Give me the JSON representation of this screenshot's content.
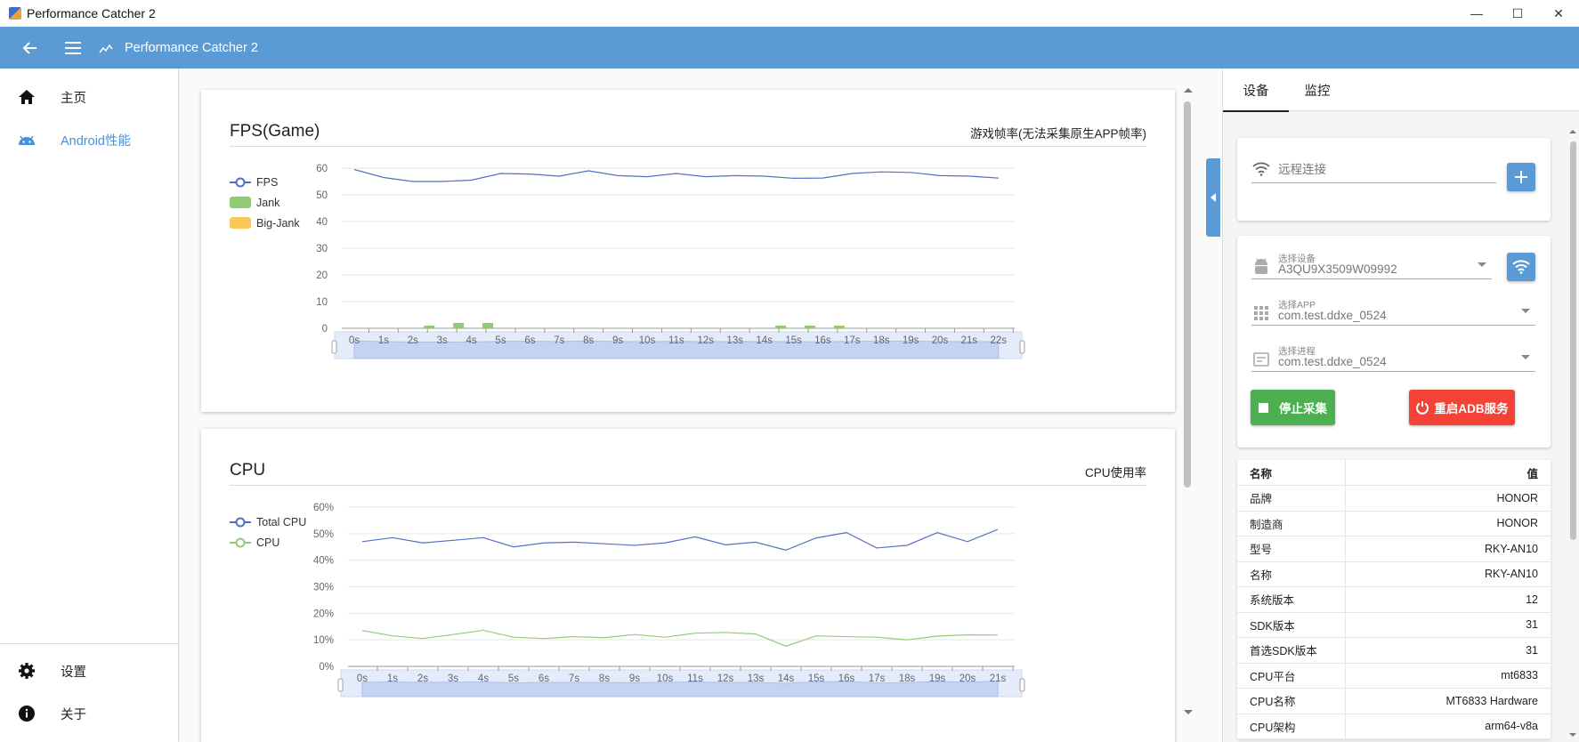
{
  "window": {
    "title": "Performance Catcher 2",
    "min": "—",
    "max": "☐",
    "close": "✕"
  },
  "appbar": {
    "title": "Performance Catcher 2"
  },
  "sidebar": {
    "items": [
      {
        "label": "主页",
        "icon": "home-icon"
      },
      {
        "label": "Android性能",
        "icon": "android-icon"
      }
    ],
    "bottom": [
      {
        "label": "设置",
        "icon": "gear-icon"
      },
      {
        "label": "关于",
        "icon": "info-icon"
      }
    ]
  },
  "fps_card": {
    "title": "FPS(Game)",
    "subtitle": "游戏帧率(无法采集原生APP帧率)"
  },
  "cpu_card": {
    "title": "CPU",
    "subtitle": "CPU使用率"
  },
  "colors": {
    "accent": "#5b9bd5",
    "fps_line": "#5470c6",
    "jank": "#91cc75",
    "big_jank": "#fac858",
    "stop": "#4caf50",
    "restart": "#f44336"
  },
  "chart_data": [
    {
      "type": "line",
      "title": "FPS(Game)",
      "subtitle": "游戏帧率(无法采集原生APP帧率)",
      "x": [
        "0s",
        "1s",
        "2s",
        "3s",
        "4s",
        "5s",
        "6s",
        "7s",
        "8s",
        "9s",
        "10s",
        "11s",
        "12s",
        "13s",
        "14s",
        "15s",
        "16s",
        "17s",
        "18s",
        "19s",
        "20s",
        "21s",
        "22s"
      ],
      "ylim": [
        0,
        60
      ],
      "yticks": [
        "0",
        "10",
        "20",
        "30",
        "40",
        "50",
        "60"
      ],
      "series": [
        {
          "name": "FPS",
          "type": "line",
          "values": [
            59.5,
            56.5,
            55,
            55,
            55.5,
            58,
            57.8,
            57,
            59,
            57.2,
            56.8,
            58,
            56.8,
            57.2,
            57,
            56.2,
            56.3,
            58,
            58.6,
            58.4,
            57.2,
            57,
            56.3
          ]
        },
        {
          "name": "Jank",
          "type": "bar",
          "values": [
            0,
            0,
            1,
            2,
            2,
            0,
            0,
            0,
            0,
            0,
            0,
            0,
            0,
            0,
            1,
            1,
            1,
            0,
            0,
            0,
            0,
            0,
            0
          ]
        },
        {
          "name": "Big-Jank",
          "type": "bar",
          "values": [
            0,
            0,
            0,
            0,
            0,
            0,
            0,
            0,
            0,
            0,
            0,
            0,
            0,
            0,
            0,
            0,
            0,
            0,
            0,
            0,
            0,
            0,
            0
          ]
        }
      ],
      "legend": "left",
      "grid": true
    },
    {
      "type": "line",
      "title": "CPU",
      "subtitle": "CPU使用率",
      "x": [
        "0s",
        "1s",
        "2s",
        "3s",
        "4s",
        "5s",
        "6s",
        "7s",
        "8s",
        "9s",
        "10s",
        "11s",
        "12s",
        "13s",
        "14s",
        "15s",
        "16s",
        "17s",
        "18s",
        "19s",
        "20s",
        "21s"
      ],
      "ylim": [
        0,
        60
      ],
      "yticks": [
        "0%",
        "10%",
        "20%",
        "30%",
        "40%",
        "50%",
        "60%"
      ],
      "series": [
        {
          "name": "Total CPU",
          "values": [
            47,
            48.5,
            46.5,
            47.5,
            48.5,
            45,
            46.5,
            46.8,
            46.2,
            45.6,
            46.5,
            48.8,
            45.8,
            46.8,
            43.8,
            48.4,
            50.4,
            44.6,
            45.6,
            50.4,
            47,
            51.6
          ]
        },
        {
          "name": "CPU",
          "values": [
            13.5,
            11.5,
            10.5,
            12,
            13.6,
            11,
            10.5,
            11.2,
            10.8,
            12,
            11,
            12.5,
            12.8,
            12.2,
            7.6,
            11.5,
            11.2,
            11,
            10,
            11.4,
            11.9,
            11.8
          ]
        }
      ],
      "legend": "left",
      "grid": true
    }
  ],
  "right": {
    "tabs": [
      "设备",
      "监控"
    ],
    "remote": {
      "placeholder": "远程连接"
    },
    "device": {
      "label": "选择设备",
      "value": "A3QU9X3509W09992"
    },
    "app": {
      "label": "选择APP",
      "value": "com.test.ddxe_0524"
    },
    "process": {
      "label": "选择进程",
      "value": "com.test.ddxe_0524"
    },
    "stop_label": "停止采集",
    "restart_label": "重启ADB服务",
    "table": {
      "head": [
        "名称",
        "值"
      ],
      "rows": [
        [
          "品牌",
          "HONOR"
        ],
        [
          "制造商",
          "HONOR"
        ],
        [
          "型号",
          "RKY-AN10"
        ],
        [
          "名称",
          "RKY-AN10"
        ],
        [
          "系统版本",
          "12"
        ],
        [
          "SDK版本",
          "31"
        ],
        [
          "首选SDK版本",
          "31"
        ],
        [
          "CPU平台",
          "mt6833"
        ],
        [
          "CPU名称",
          "MT6833 Hardware"
        ],
        [
          "CPU架构",
          "arm64-v8a"
        ]
      ]
    }
  }
}
